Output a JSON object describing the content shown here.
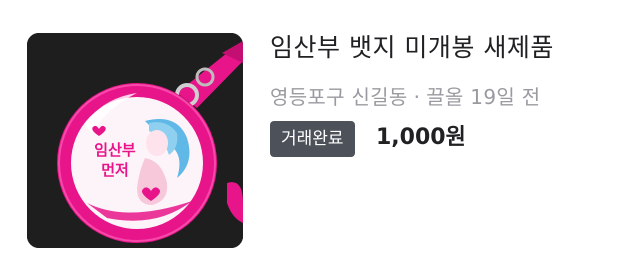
{
  "listing": {
    "title": "임산부 뱃지 미개봉 새제품",
    "location": "영등포구 신길동",
    "separator": "·",
    "time": "끌올 19일 전",
    "status": "거래완료",
    "price": "1,000원",
    "thumbnail": {
      "icon": "pregnancy-badge-keychain-photo",
      "badge_text_line1": "임산부",
      "badge_text_line2": "먼저",
      "colors": {
        "background": "#1a1a1a",
        "badge_rim": "#e8158a",
        "badge_face": "#ffffff",
        "hair": "#5fb8e6",
        "strap": "#e8158a"
      }
    }
  },
  "colors": {
    "title_text": "#212124",
    "meta_text": "#9a9aa0",
    "badge_bg": "#4d5159",
    "badge_text": "#ffffff"
  }
}
